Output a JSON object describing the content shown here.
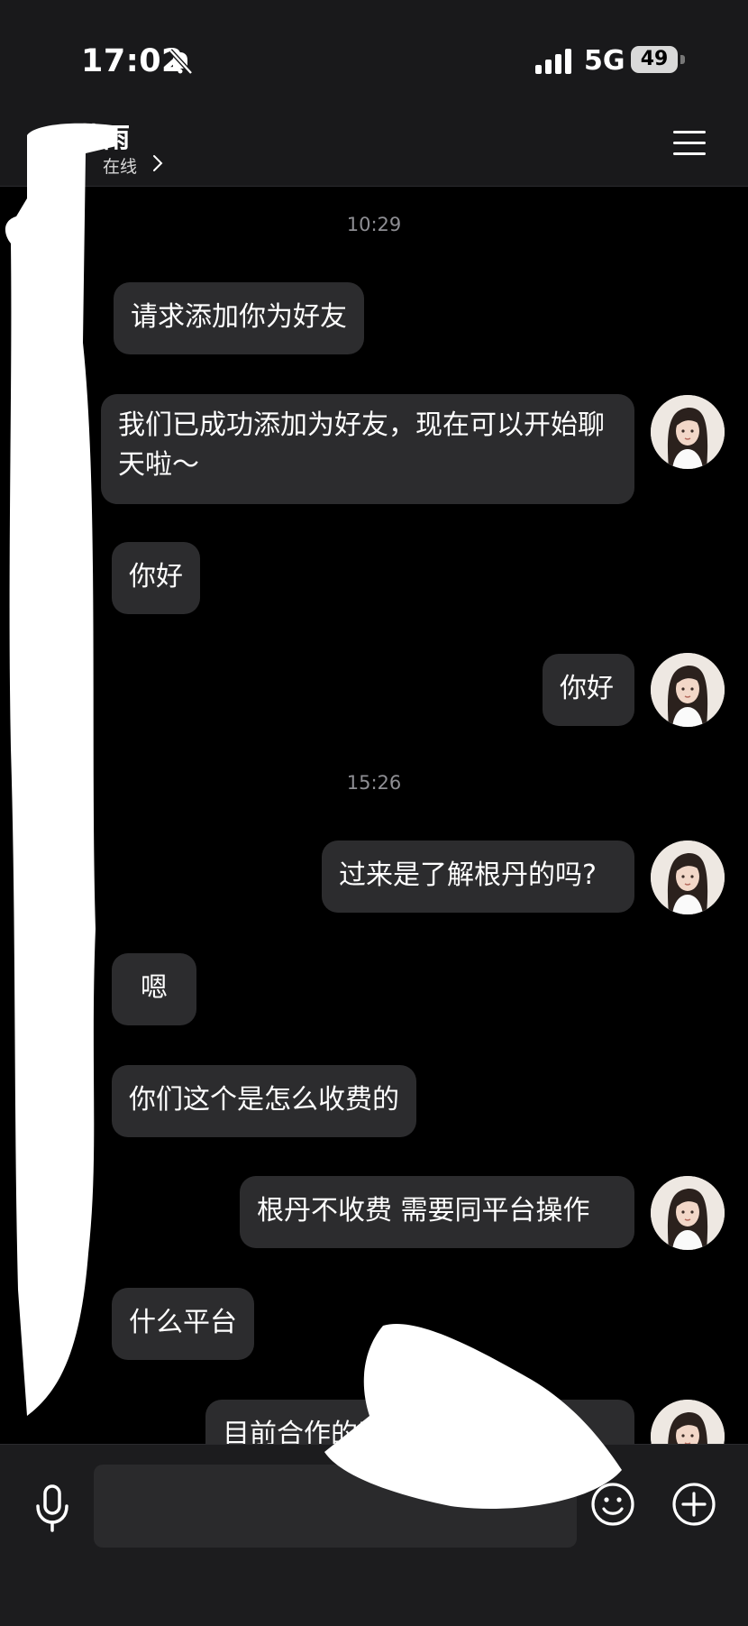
{
  "status_bar": {
    "time": "17:02",
    "network": "5G",
    "battery": "49"
  },
  "header": {
    "title": "黄雨",
    "presence": "在线"
  },
  "messages": [
    {
      "kind": "timestamp",
      "text": "10:29"
    },
    {
      "kind": "received",
      "text": "请求添加你为好友"
    },
    {
      "kind": "sent",
      "text": "我们已成功添加为好友，现在可以开始聊天啦～"
    },
    {
      "kind": "received",
      "text": "你好"
    },
    {
      "kind": "sent",
      "text": "你好"
    },
    {
      "kind": "timestamp",
      "text": "15:26"
    },
    {
      "kind": "sent",
      "text": "过来是了解根丹的吗?"
    },
    {
      "kind": "received",
      "text": "嗯"
    },
    {
      "kind": "received",
      "text": "你们这个是怎么收费的"
    },
    {
      "kind": "sent",
      "text": "根丹不收费 需要同平台操作"
    },
    {
      "kind": "received",
      "text": "什么平台"
    },
    {
      "kind": "sent",
      "text": "目前合作的平台"
    }
  ],
  "input_bar": {
    "placeholder": ""
  },
  "icons": {
    "back": "chevron-left-icon",
    "presence": "chevron-right-icon",
    "menu": "hamburger-menu-icon",
    "mic": "microphone-icon",
    "emoji": "smiley-icon",
    "plus": "plus-circle-icon",
    "silent": "bell-slash-icon",
    "signal": "signal-bars-icon"
  },
  "colors": {
    "background": "#000000",
    "bar": "#1c1c1e",
    "bubble": "#2c2c2e",
    "text": "#ffffff",
    "muted": "#8e8e93"
  }
}
